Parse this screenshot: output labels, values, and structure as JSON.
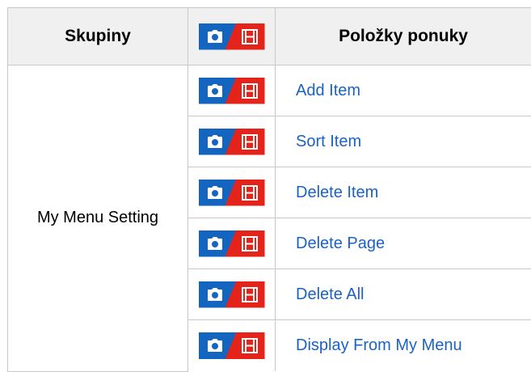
{
  "table": {
    "headers": {
      "groups": "Skupiny",
      "items": "Položky ponuky"
    },
    "group_label": "My Menu Setting",
    "rows": [
      {
        "label": "Add Item"
      },
      {
        "label": "Sort Item"
      },
      {
        "label": "Delete Item"
      },
      {
        "label": "Delete Page"
      },
      {
        "label": "Delete All"
      },
      {
        "label": "Display From My Menu"
      }
    ]
  },
  "icons": {
    "mode_badge": "photo-movie-mode-icon",
    "photo_color": "#1465c0",
    "movie_color": "#e4231b"
  },
  "colors": {
    "link": "#1a62c6",
    "header_bg": "#f0f0f0",
    "border": "#c8c8c8"
  }
}
